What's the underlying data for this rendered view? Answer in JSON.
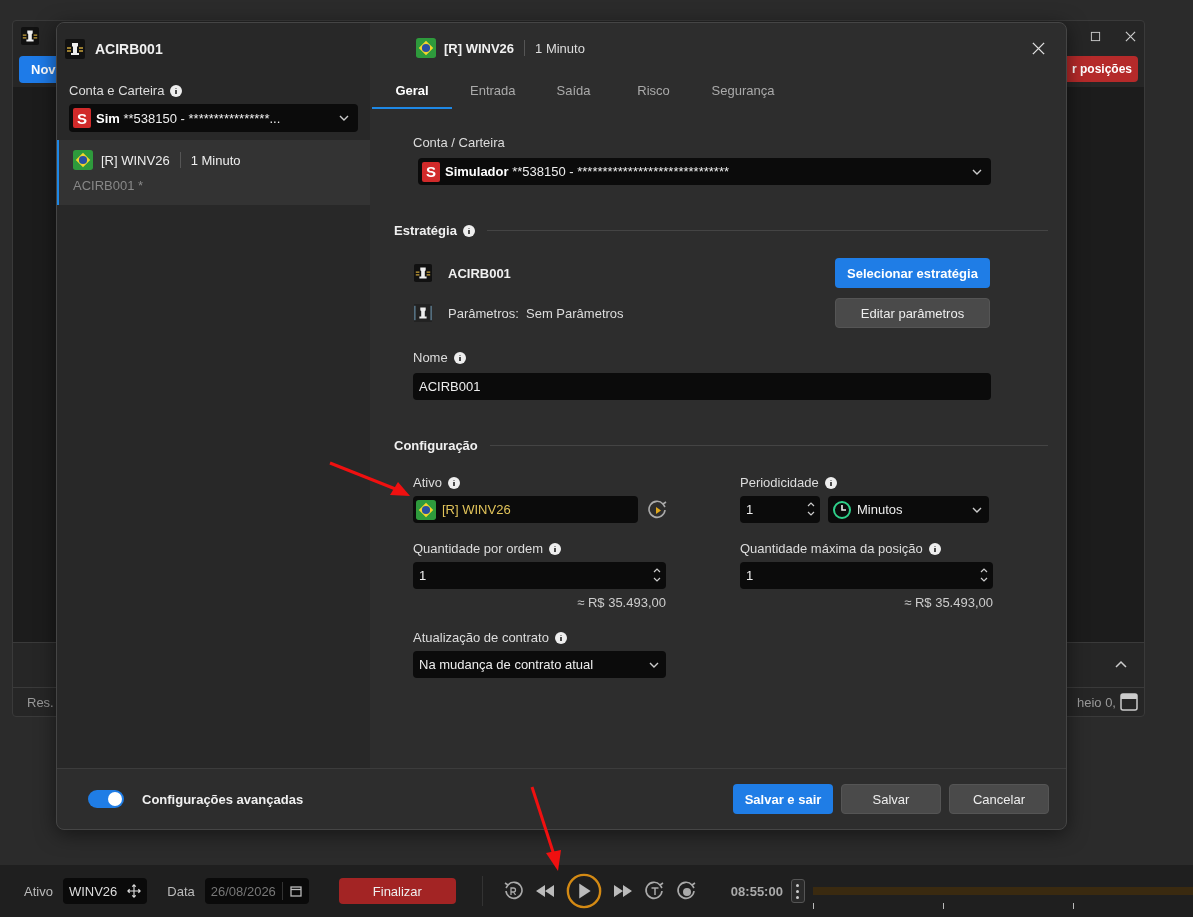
{
  "background_window": {
    "new_button": "Nov",
    "close_positions_button": "r posições",
    "status_left": "Res.",
    "status_right": "heio 0,"
  },
  "modal": {
    "sidebar": {
      "title": "ACIRB001",
      "account_label": "Conta e Carteira",
      "account": {
        "badge": "S",
        "name": "Sim",
        "number": "**538150 - ****************..."
      },
      "items": [
        {
          "asset": "[R] WINV26",
          "period": "1 Minuto",
          "name": "ACIRB001 *",
          "selected": true
        }
      ]
    },
    "header": {
      "asset": "[R] WINV26",
      "period": "1 Minuto"
    },
    "tabs": [
      {
        "label": "Geral",
        "selected": true
      },
      {
        "label": "Entrada",
        "selected": false
      },
      {
        "label": "Saída",
        "selected": false
      },
      {
        "label": "Risco",
        "selected": false
      },
      {
        "label": "Segurança",
        "selected": false
      }
    ],
    "account": {
      "label": "Conta / Carteira",
      "badge": "S",
      "name": "Simulador",
      "number": "**538150 - ******************************"
    },
    "strategy": {
      "title": "Estratégia",
      "name": "ACIRB001",
      "select_button": "Selecionar estratégia",
      "params_label": "Parâmetros:",
      "params_value": "Sem Parâmetros",
      "edit_button": "Editar parâmetros",
      "name_label": "Nome",
      "name_value": "ACIRB001"
    },
    "config": {
      "title": "Configuração",
      "asset_label": "Ativo",
      "asset_value": "[R] WINV26",
      "period_label": "Periodicidade",
      "period_value": "1",
      "period_unit": "Minutos",
      "qty_label": "Quantidade por ordem",
      "qty_value": "1",
      "qty_approx": "≈ R$ 35.493,00",
      "max_label": "Quantidade máxima da posição",
      "max_value": "1",
      "max_approx": "≈ R$ 35.493,00",
      "update_label": "Atualização de contrato",
      "update_value": "Na mudança de contrato atual"
    },
    "footer": {
      "toggle": {
        "label": "Configurações avançadas",
        "on": true
      },
      "buttons": [
        {
          "label": "Salvar e sair",
          "kind": "primary"
        },
        {
          "label": "Salvar",
          "kind": "secondary"
        },
        {
          "label": "Cancelar",
          "kind": "secondary"
        }
      ]
    }
  },
  "player": {
    "asset_label": "Ativo",
    "asset": "WINV26",
    "date_label": "Data",
    "date": "26/08/2026",
    "finish_button": "Finalizar",
    "time": "08:55:00"
  }
}
